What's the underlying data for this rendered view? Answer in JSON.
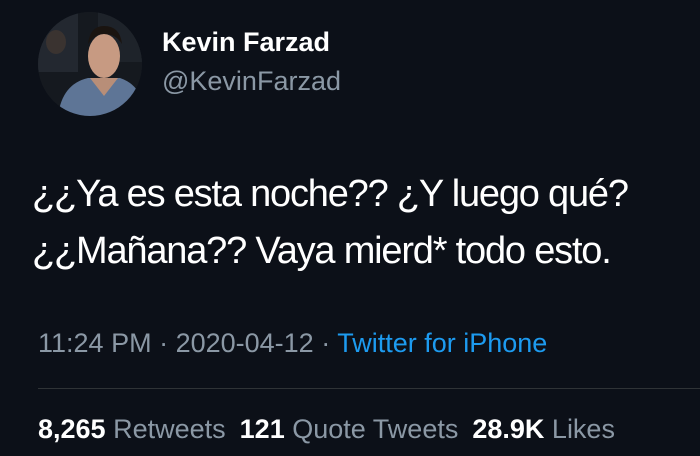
{
  "author": {
    "display_name": "Kevin Farzad",
    "handle": "@KevinFarzad"
  },
  "tweet": {
    "lines": [
      "¿¿Ya es esta noche?? ¿Y luego qué?",
      "¿¿Mañana?? Vaya mierd* todo esto."
    ]
  },
  "meta": {
    "time": "11:24 PM",
    "sep1": " · ",
    "date": "2020-04-12",
    "sep2": " · ",
    "source": "Twitter for iPhone"
  },
  "stats": {
    "retweets_count": "8,265",
    "retweets_label": "Retweets",
    "quotes_count": "121",
    "quotes_label": "Quote Tweets",
    "likes_count": "28.9K",
    "likes_label": "Likes"
  },
  "colors": {
    "background": "#0c1018",
    "primary_text": "#ffffff",
    "secondary_text": "#8b98a5",
    "link": "#1d9bf0"
  }
}
